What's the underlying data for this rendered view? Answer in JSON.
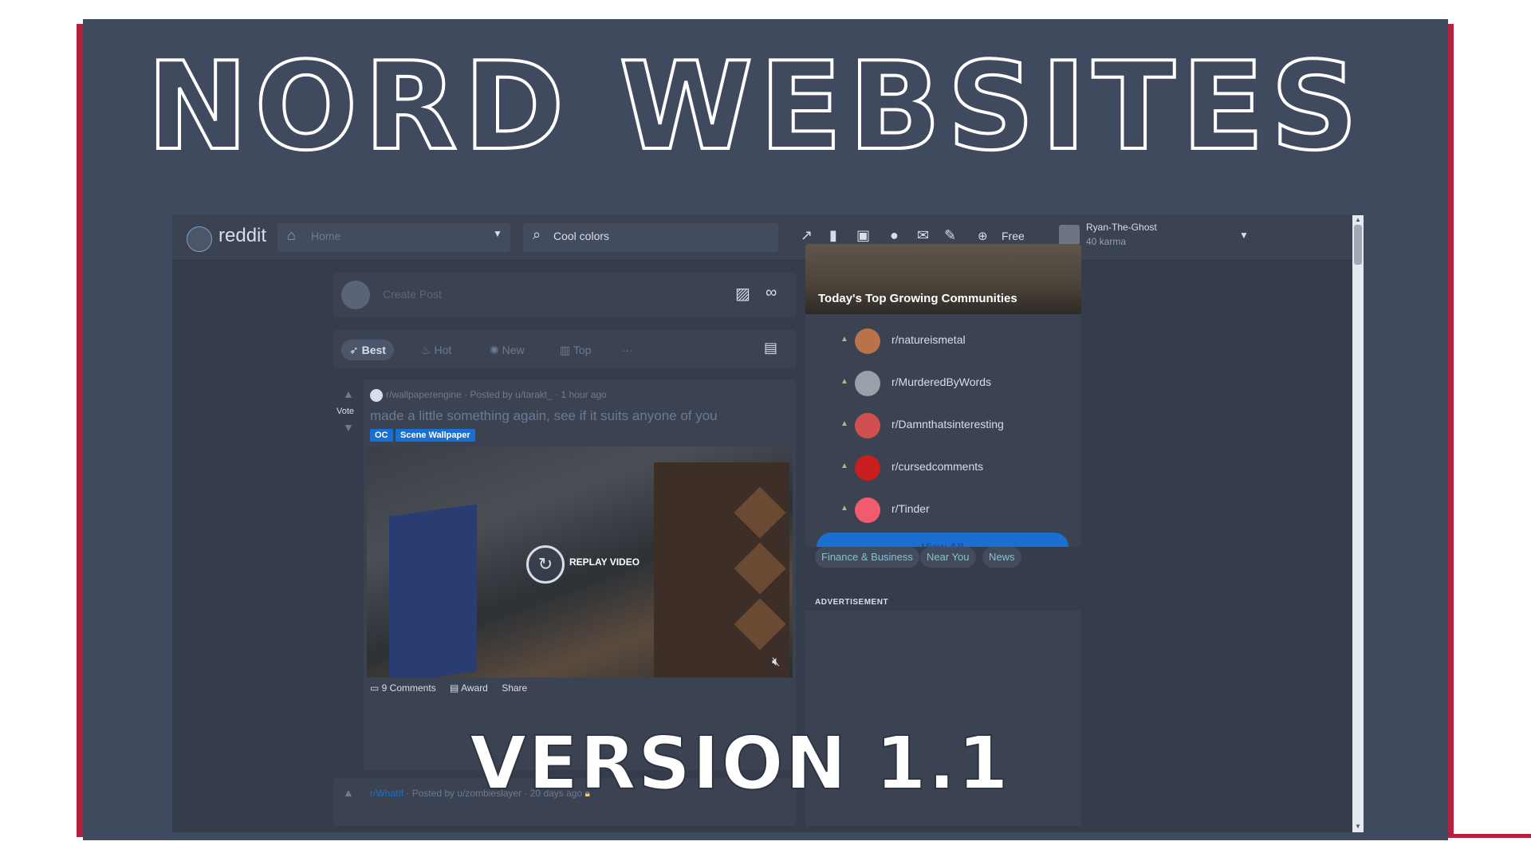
{
  "colors": {
    "background": "#404a5e",
    "frame_accent": "#b3213f",
    "panel": "#3b4252",
    "text": "#d8dee9",
    "link_blue": "#1a6fd1"
  },
  "banner": {
    "title": "NORD WEBSITES",
    "version": "VERSION 1.1"
  },
  "topbar": {
    "logo_text": "reddit",
    "home_label": "Home",
    "search_value": "Cool colors",
    "icons": [
      "trending-icon",
      "stats-icon",
      "video-icon",
      "chat-icon",
      "mail-icon",
      "pencil-icon"
    ],
    "coins_label": "Free",
    "username": "Ryan-The-Ghost",
    "karma": "40 karma"
  },
  "create_post": {
    "placeholder": "Create Post"
  },
  "sort": {
    "items": [
      {
        "label": "Best",
        "icon": "rocket-icon"
      },
      {
        "label": "Hot",
        "icon": "flame-icon"
      },
      {
        "label": "New",
        "icon": "sun-icon"
      },
      {
        "label": "Top",
        "icon": "bar-chart-icon"
      }
    ],
    "more": "···"
  },
  "post": {
    "vote_label": "Vote",
    "subreddit": "r/wallpaperengine",
    "posted_by": "· Posted by u/tarakt_ · 1 hour ago",
    "title": "made a little something again, see if it suits anyone of you",
    "flairs": [
      "OC",
      "Scene Wallpaper"
    ],
    "replay_label": "REPLAY VIDEO",
    "comments": "9 Comments",
    "award": "Award",
    "share": "Share"
  },
  "next_post": {
    "subreddit": "r/WhatIf",
    "posted_by": "· Posted by u/zombieslayer · 20 days ago"
  },
  "sidebar": {
    "header": "Today's Top Growing Communities",
    "communities": [
      {
        "name": "r/natureismetal",
        "color": "#b8734a"
      },
      {
        "name": "r/MurderedByWords",
        "color": "#9aa0a8"
      },
      {
        "name": "r/Damnthatsinteresting",
        "color": "#d05050"
      },
      {
        "name": "r/cursedcomments",
        "color": "#c81e1e"
      },
      {
        "name": "r/Tinder",
        "color": "#f25a6e"
      }
    ],
    "view_all": "View All",
    "chips": [
      "Finance & Business",
      "Near You",
      "News"
    ],
    "advertisement": "ADVERTISEMENT"
  }
}
